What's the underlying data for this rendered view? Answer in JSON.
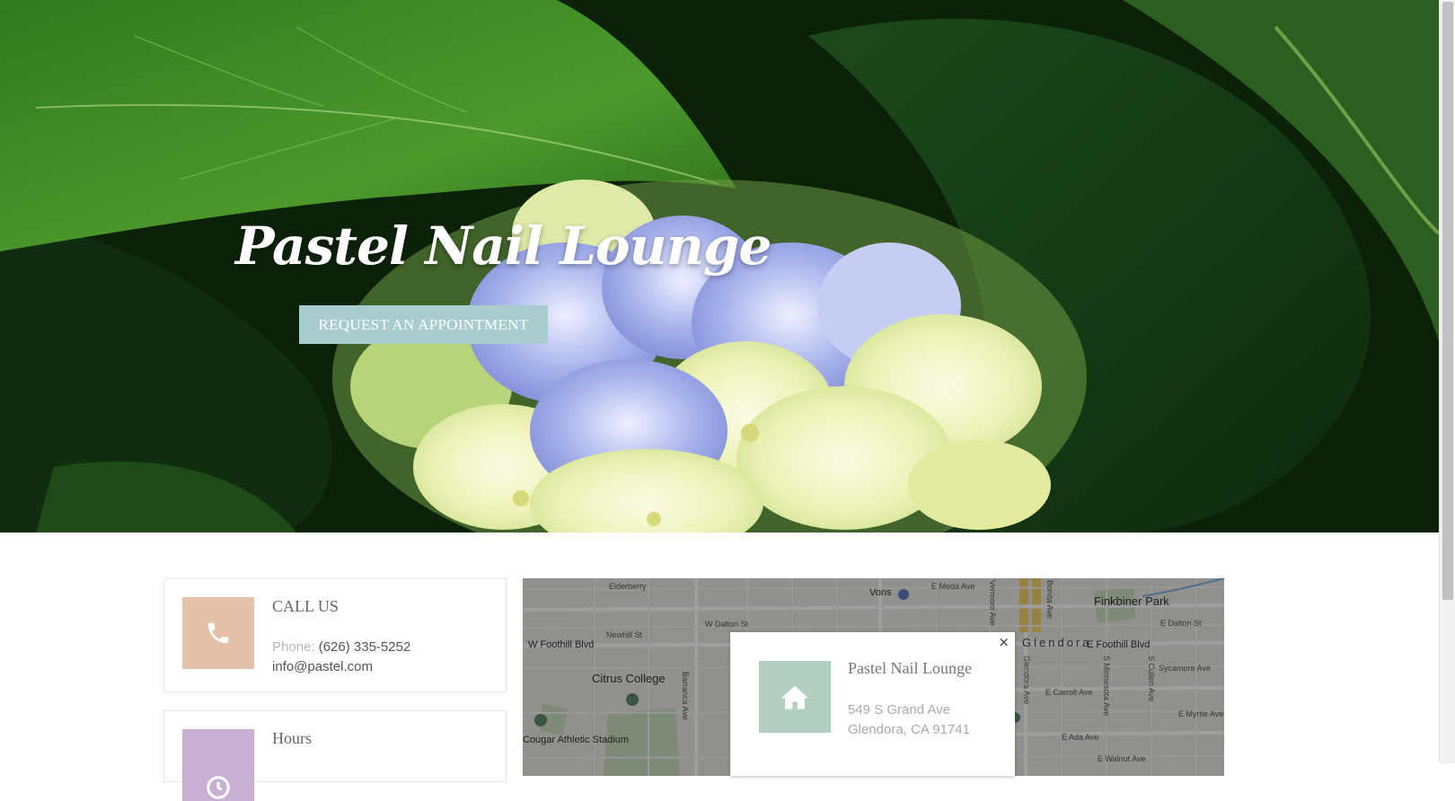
{
  "hero": {
    "title": "Pastel Nail Lounge",
    "cta_label": "REQUEST AN APPOINTMENT"
  },
  "contact": {
    "title": "CALL US",
    "phone_label": "Phone:",
    "phone": "(626) 335-5252",
    "email": "info@pastel.com",
    "icon": "phone-icon"
  },
  "hours": {
    "title": "Hours",
    "icon": "clock-icon"
  },
  "map": {
    "labels": {
      "vons": "Vons",
      "e_meda": "E Meda Ave",
      "finkbiner": "Finkbiner Park",
      "e_dalton": "E Dalton St",
      "w_dalton": "W Dalton St",
      "newhill": "Newhill St",
      "w_foothill": "W Foothill Blvd",
      "e_foothill": "E Foothill Blvd",
      "citrus": "Citrus College",
      "barranca": "Barranca Ave",
      "vermont": "Vermont Ave",
      "glendora_ave": "Glendora Ave",
      "bonita": "Bonita Ave",
      "minnesota": "S Minnesota Ave",
      "cullen": "S Cullen Ave",
      "sycamore": "Sycamore Ave",
      "carroll": "E Carroll Ave",
      "myrtle": "E Myrtle Ave",
      "ada": "E Ada Ave",
      "walnut": "E Walnut Ave",
      "cougar": "Cougar Athletic Stadium",
      "glendora_city": "Glendora",
      "elderberry": "Elderberry"
    },
    "popup": {
      "name": "Pastel Nail Lounge",
      "address1": "549 S Grand Ave",
      "address2": "Glendora, CA 91741",
      "close": "×",
      "icon": "home-icon"
    }
  },
  "colors": {
    "cta": "#a9cdce",
    "phone_tile": "#e5c1a9",
    "hours_tile": "#c7b0d4",
    "home_tile": "#b1d0bf"
  }
}
